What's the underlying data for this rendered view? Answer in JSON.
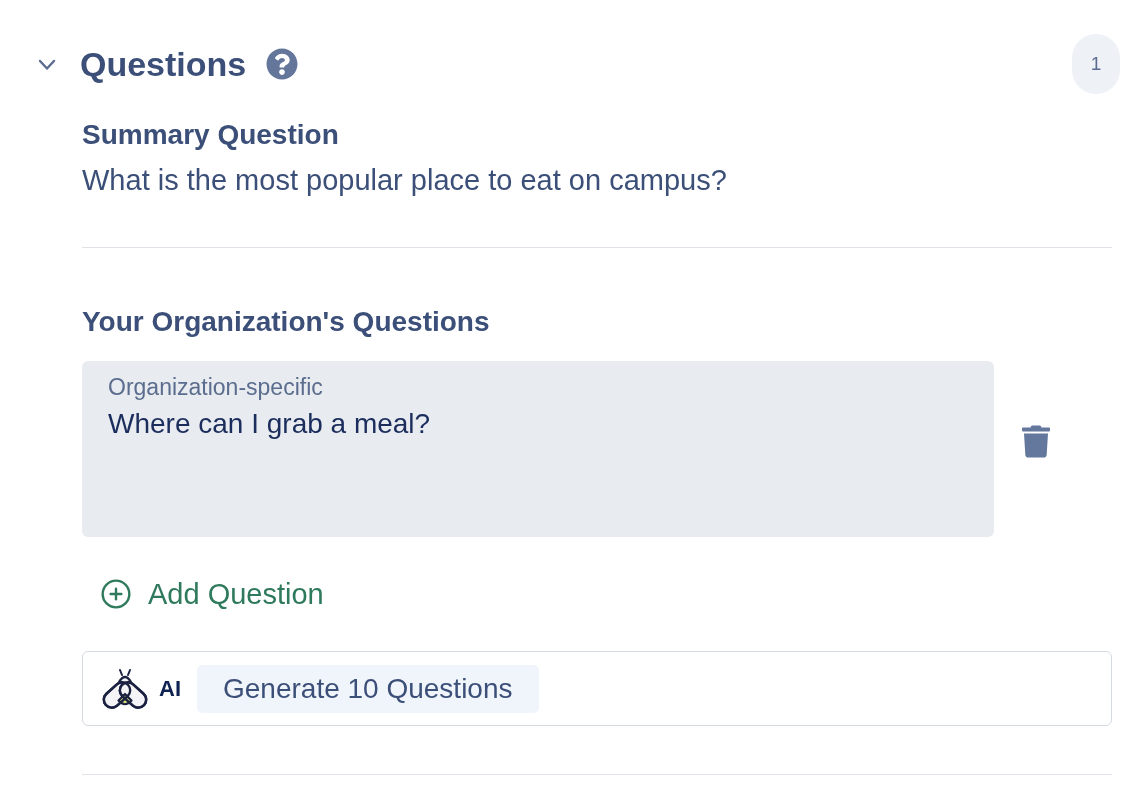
{
  "section": {
    "title": "Questions",
    "expanded": true,
    "count": "1"
  },
  "summary": {
    "label": "Summary Question",
    "text": "What is the most popular place to eat on campus?"
  },
  "organization_questions": {
    "heading": "Your Organization's Questions",
    "items": [
      {
        "label": "Organization-specific",
        "value": "Where can I grab a meal?"
      }
    ]
  },
  "add_button": {
    "label": "Add Question"
  },
  "ai_bar": {
    "badge": "AI",
    "button": "Generate 10 Questions"
  }
}
